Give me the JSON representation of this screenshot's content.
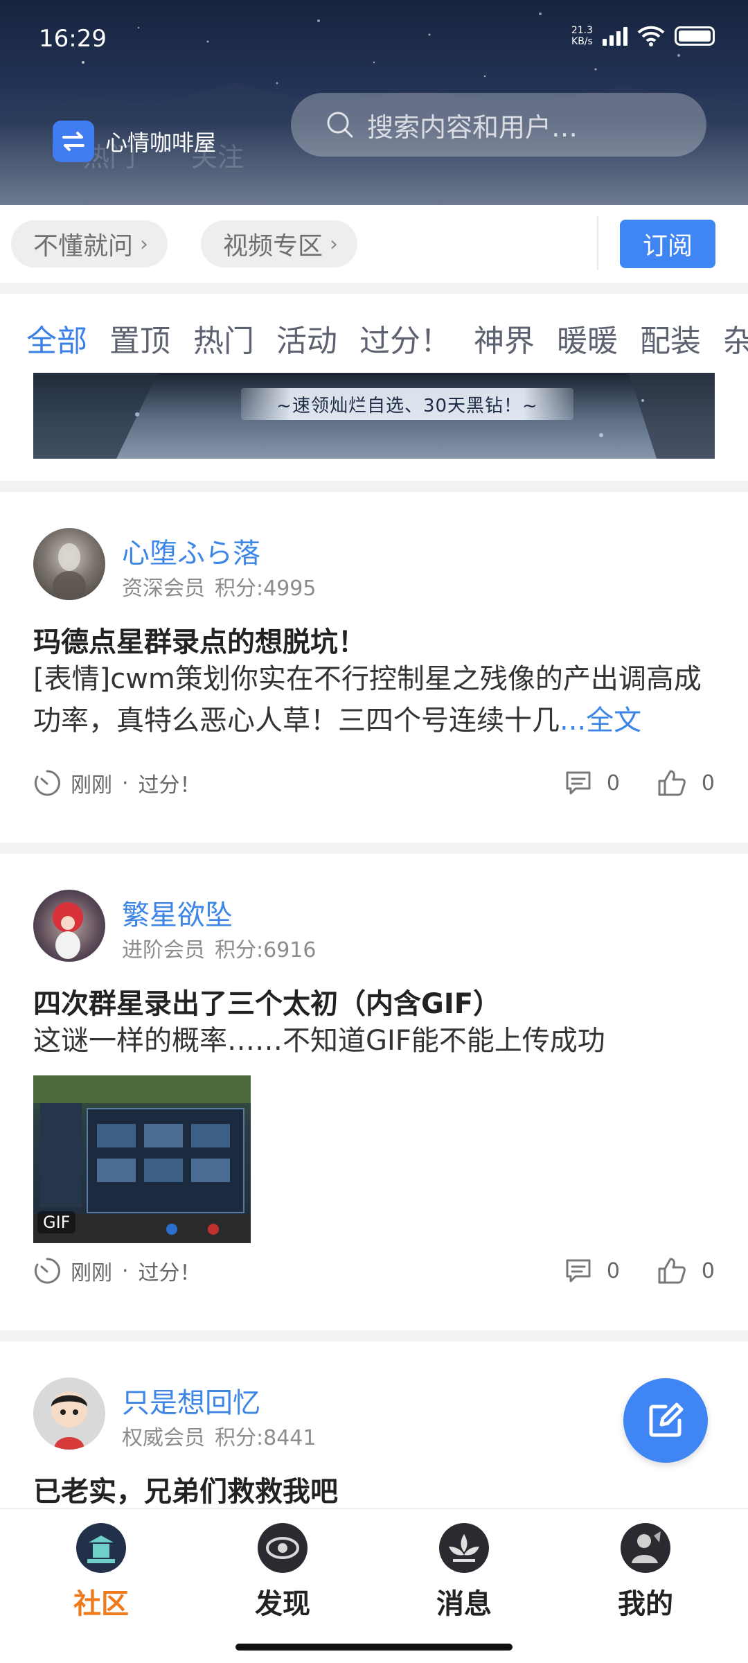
{
  "status_bar": {
    "time": "16:29",
    "net_speed_value": "21.3",
    "net_speed_unit": "KB/s"
  },
  "header": {
    "forum_name": "心情咖啡屋",
    "search_placeholder": "搜索内容和用户…",
    "ghost_tabs": [
      "热门",
      "关注"
    ]
  },
  "shortcuts": {
    "chip_1": "不懂就问",
    "chip_2": "视频专区",
    "subscribe": "订阅"
  },
  "category_tabs": [
    "全部",
    "置顶",
    "热门",
    "活动",
    "过分！",
    "神界",
    "暖暖",
    "配装",
    "杂"
  ],
  "active_tab_index": 0,
  "banner": {
    "text": "~速领灿烂自选、30天黑钻！~"
  },
  "posts": [
    {
      "user_name": "心堕ふら落",
      "level": "资深会员",
      "points": "积分:4995",
      "title": "玛德点星群录点的想脱坑！",
      "body": "[表情]cwm策划你实在不行控制星之残像的产出调高成功率，真特么恶心人草！三四个号连续十几",
      "read_more": "...全文",
      "time": "刚刚",
      "board": "过分！",
      "comments": "0",
      "likes": "0"
    },
    {
      "user_name": "繁星欲坠",
      "level": "进阶会员",
      "points": "积分:6916",
      "title": "四次群星录出了三个太初（内含GIF）",
      "body": "这谜一样的概率……不知道GIF能不能上传成功",
      "gif_badge": "GIF",
      "time": "刚刚",
      "board": "过分！",
      "comments": "0",
      "likes": "0"
    },
    {
      "user_name": "只是想回忆",
      "level": "权威会员",
      "points": "积分:8441",
      "title": "已老实，兄弟们救救我吧"
    }
  ],
  "bottom_nav": [
    {
      "label": "社区",
      "active": true
    },
    {
      "label": "发现",
      "active": false
    },
    {
      "label": "消息",
      "active": false
    },
    {
      "label": "我的",
      "active": false
    }
  ],
  "colors": {
    "accent_blue": "#3f85f4",
    "link_blue": "#3d86e5",
    "active_orange": "#ef7a1c"
  }
}
